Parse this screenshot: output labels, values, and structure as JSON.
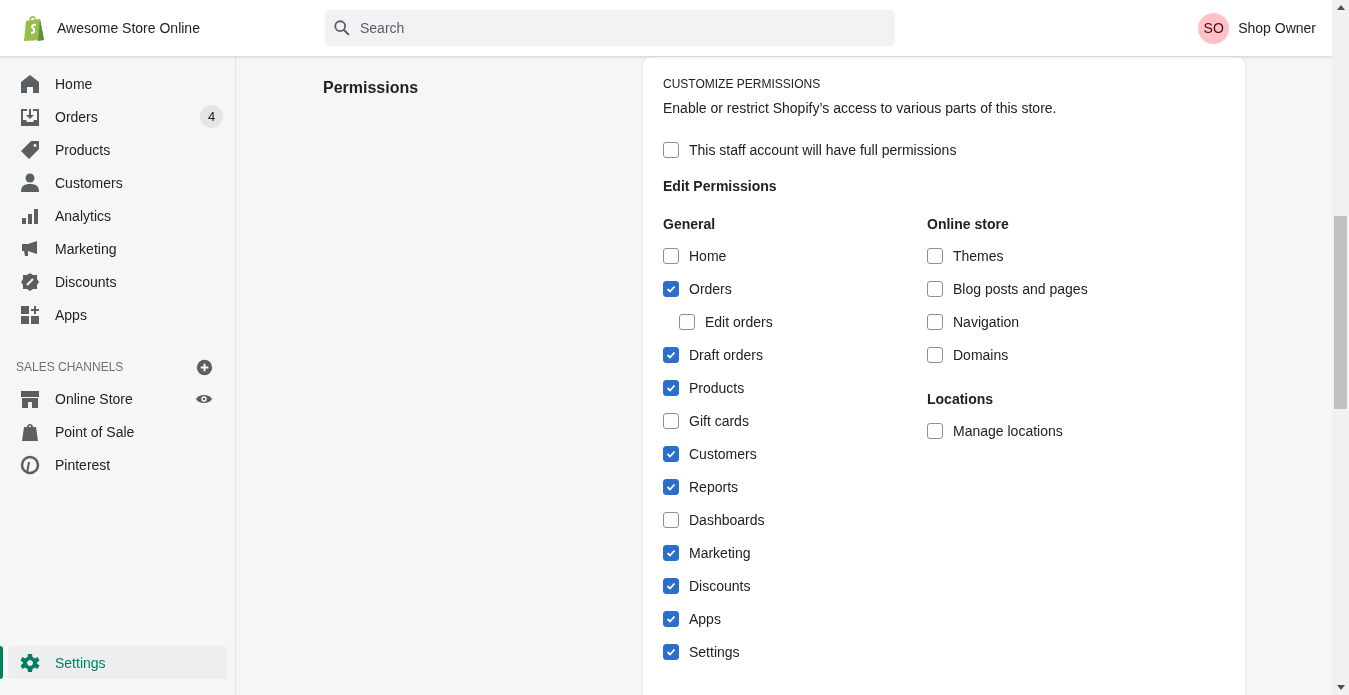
{
  "topbar": {
    "store_name": "Awesome Store Online",
    "search": {
      "placeholder": "Search"
    },
    "user": {
      "initials": "SO",
      "name": "Shop Owner"
    }
  },
  "sidebar": {
    "items": [
      {
        "label": "Home",
        "kind": "home",
        "selected": false
      },
      {
        "label": "Orders",
        "kind": "orders",
        "selected": false,
        "badge": "4"
      },
      {
        "label": "Products",
        "kind": "products",
        "selected": false
      },
      {
        "label": "Customers",
        "kind": "customers",
        "selected": false
      },
      {
        "label": "Analytics",
        "kind": "analytics",
        "selected": false
      },
      {
        "label": "Marketing",
        "kind": "marketing",
        "selected": false
      },
      {
        "label": "Discounts",
        "kind": "discounts",
        "selected": false
      },
      {
        "label": "Apps",
        "kind": "apps",
        "selected": false
      }
    ],
    "sales_channels": {
      "heading": "SALES CHANNELS",
      "items": [
        {
          "label": "Online Store",
          "kind": "store",
          "selected": false
        },
        {
          "label": "Point of Sale",
          "kind": "pos",
          "selected": false
        },
        {
          "label": "Pinterest",
          "kind": "pinterest",
          "selected": false
        }
      ]
    },
    "footer_item": {
      "label": "Settings",
      "kind": "settings",
      "selected": true
    }
  },
  "section": {
    "title": "Permissions"
  },
  "card": {
    "heading": "CUSTOMIZE PERMISSIONS",
    "description": "Enable or restrict Shopify’s access to various parts of this store.",
    "full_permissions": {
      "label": "This staff account will have full permissions",
      "checked": false
    },
    "edit_heading": "Edit Permissions",
    "columns": [
      {
        "groups": [
          {
            "title": "General",
            "items": [
              {
                "label": "Home",
                "checked": false
              },
              {
                "label": "Orders",
                "checked": true,
                "children": [
                  {
                    "label": "Edit orders",
                    "checked": false
                  }
                ]
              },
              {
                "label": "Draft orders",
                "checked": true
              },
              {
                "label": "Products",
                "checked": true
              },
              {
                "label": "Gift cards",
                "checked": false
              },
              {
                "label": "Customers",
                "checked": true
              },
              {
                "label": "Reports",
                "checked": true
              },
              {
                "label": "Dashboards",
                "checked": false
              },
              {
                "label": "Marketing",
                "checked": true
              },
              {
                "label": "Discounts",
                "checked": true
              },
              {
                "label": "Apps",
                "checked": true
              },
              {
                "label": "Settings",
                "checked": true
              }
            ]
          }
        ]
      },
      {
        "groups": [
          {
            "title": "Online store",
            "items": [
              {
                "label": "Themes",
                "checked": false
              },
              {
                "label": "Blog posts and pages",
                "checked": false
              },
              {
                "label": "Navigation",
                "checked": false
              },
              {
                "label": "Domains",
                "checked": false
              }
            ]
          },
          {
            "title": "Locations",
            "items": [
              {
                "label": "Manage locations",
                "checked": false
              }
            ]
          }
        ]
      }
    ]
  }
}
